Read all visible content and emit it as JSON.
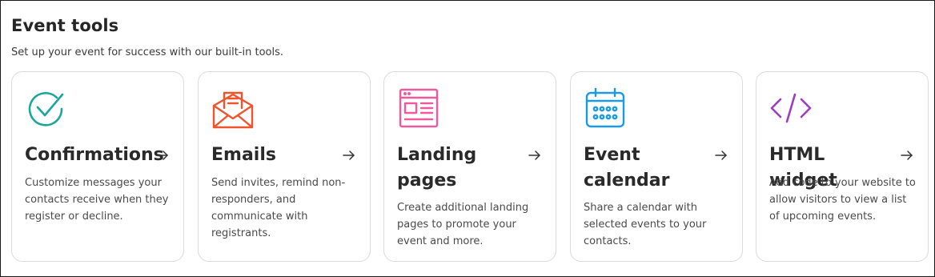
{
  "section": {
    "title": "Event tools",
    "subtitle": "Set up your event for success with our built-in tools."
  },
  "cards": [
    {
      "title": "Confirmations",
      "description": "Customize messages your contacts receive when they register or decline.",
      "icon": "check-circle-icon",
      "color": "#18a79a"
    },
    {
      "title": "Emails",
      "description": "Send invites, remind non-responders, and communicate with registrants.",
      "icon": "envelope-letter-icon",
      "color": "#f0542d"
    },
    {
      "title": "Landing pages",
      "description": "Create additional landing pages to promote your event and more.",
      "icon": "webpage-layout-icon",
      "color": "#ef5a9c"
    },
    {
      "title": "Event calendar",
      "description": "Share a calendar with selected events to your contacts.",
      "icon": "calendar-icon",
      "color": "#1b9ae8"
    },
    {
      "title": "HTML widget",
      "description": "Add code to your website to allow visitors to view a list of upcoming events.",
      "icon": "code-brackets-icon",
      "color": "#9b3fc0"
    }
  ],
  "arrow_icon": "arrow-right-icon"
}
